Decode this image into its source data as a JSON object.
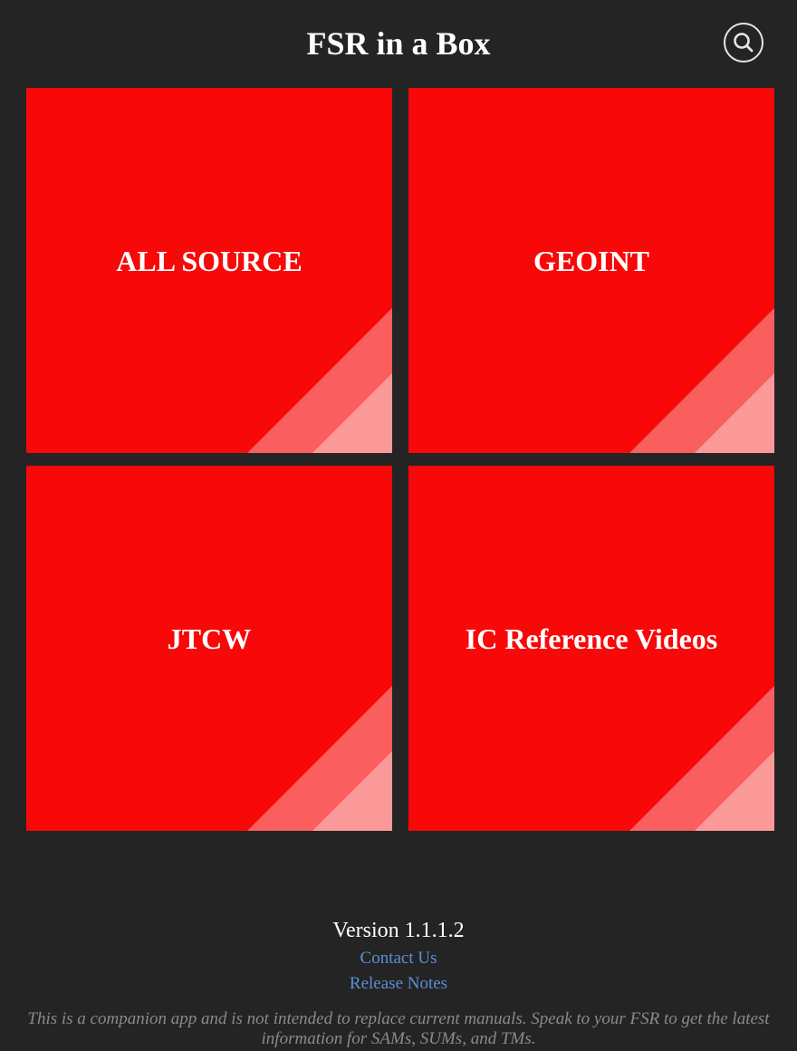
{
  "header": {
    "title": "FSR in a Box",
    "search_icon": "search-icon"
  },
  "tiles": [
    {
      "label": "ALL SOURCE"
    },
    {
      "label": "GEOINT"
    },
    {
      "label": "JTCW"
    },
    {
      "label": "IC Reference Videos"
    }
  ],
  "footer": {
    "version": "Version 1.1.1.2",
    "contact_link": "Contact Us",
    "release_notes_link": "Release Notes",
    "disclaimer": "This is a companion app and is not intended to replace current manuals. Speak to your FSR to get the latest information for SAMs, SUMs, and TMs."
  },
  "colors": {
    "background": "#242424",
    "tile": "#f80808",
    "tile_stripe_mid": "#fa5e5e",
    "tile_stripe_light": "#fb9999",
    "link": "#5b8fd9",
    "disclaimer": "#8a8a8a"
  }
}
